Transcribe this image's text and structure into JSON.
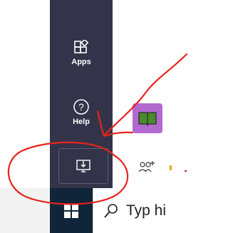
{
  "sidebar": {
    "background": "#33344a",
    "items": [
      {
        "label": "Apps",
        "icon": "apps-icon"
      },
      {
        "label": "Help",
        "icon": "help-icon"
      },
      {
        "label": "",
        "icon": "download-icon"
      }
    ]
  },
  "content": {
    "app_tile_icon": "book-icon",
    "app_tile_color": "#b36ad0",
    "people_icon": "add-people-icon"
  },
  "taskbar": {
    "start_icon": "windows-logo-icon",
    "search_icon": "search-icon",
    "search_placeholder": "Typ hi"
  },
  "annotation": {
    "color": "#e8231b"
  }
}
